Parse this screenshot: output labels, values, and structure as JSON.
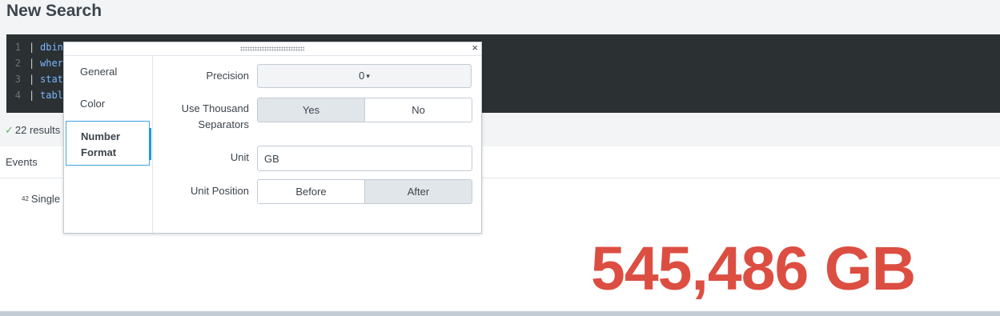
{
  "page": {
    "title": "New Search"
  },
  "editor": {
    "lines": [
      {
        "num": "1",
        "pipe": "|",
        "text": "dbin"
      },
      {
        "num": "2",
        "pipe": "|",
        "text": "wher"
      },
      {
        "num": "3",
        "pipe": "|",
        "text": "stat"
      },
      {
        "num": "4",
        "pipe": "|",
        "text": "tabl"
      }
    ]
  },
  "results": {
    "check": "✓",
    "text": "22 results"
  },
  "tabs": {
    "events": "Events"
  },
  "visualization": {
    "icon": "42",
    "label": "Single",
    "value": "545,486 GB",
    "value_color": "#dc4e41"
  },
  "dialog": {
    "close": "×",
    "nav": {
      "general": "General",
      "color": "Color",
      "number_format_line1": "Number",
      "number_format_line2": "Format"
    },
    "precision": {
      "label": "Precision",
      "value": "0",
      "caret": "▾"
    },
    "thousand": {
      "label_line1": "Use Thousand",
      "label_line2": "Separators",
      "yes": "Yes",
      "no": "No",
      "selected": "Yes"
    },
    "unit": {
      "label": "Unit",
      "value": "GB"
    },
    "unit_position": {
      "label": "Unit Position",
      "before": "Before",
      "after": "After",
      "selected": "After"
    }
  },
  "colors": {
    "accent": "#1a9be6",
    "value": "#dc4e41",
    "editor_bg": "#2b3033"
  }
}
